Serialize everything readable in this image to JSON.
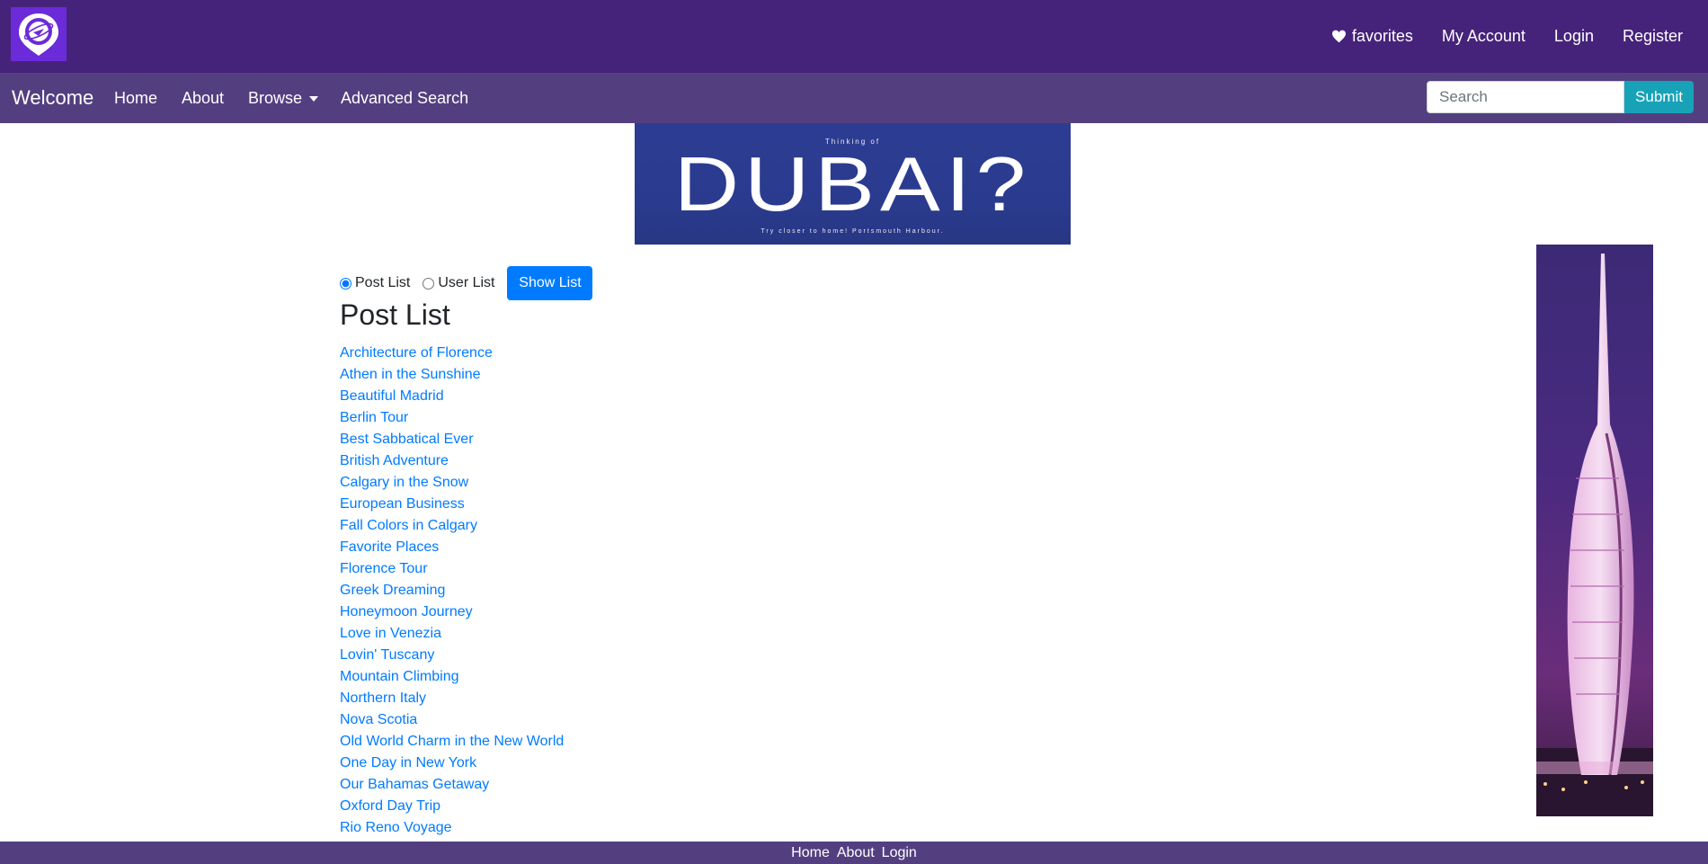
{
  "header": {
    "logo_icon": "globe-pin-icon",
    "links": {
      "favorites": "favorites",
      "favorites_icon": "heart-icon",
      "account": "My Account",
      "login": "Login",
      "register": "Register"
    }
  },
  "navbar": {
    "brand": "Welcome",
    "items": {
      "home": "Home",
      "about": "About",
      "browse": "Browse",
      "advanced": "Advanced Search"
    },
    "search": {
      "placeholder": "Search",
      "value": ""
    },
    "submit": "Submit"
  },
  "ad_banner": {
    "top_line": "Thinking of",
    "headline": "DUBAI?",
    "bottom_line": "Try closer to home! Portsmouth Harbour."
  },
  "list_controls": {
    "options": [
      "Post List",
      "User List"
    ],
    "selected": "Post List",
    "button": "Show List"
  },
  "post_list": {
    "heading": "Post List",
    "items": [
      "Architecture of Florence",
      "Athen in the Sunshine",
      "Beautiful Madrid",
      "Berlin Tour",
      "Best Sabbatical Ever",
      "British Adventure",
      "Calgary in the Snow",
      "European Business",
      "Fall Colors in Calgary",
      "Favorite Places",
      "Florence Tour",
      "Greek Dreaming",
      "Honeymoon Journey",
      "Love in Venezia",
      "Lovin' Tuscany",
      "Mountain Climbing",
      "Northern Italy",
      "Nova Scotia",
      "Old World Charm in the New World",
      "One Day in New York",
      "Our Bahamas Getaway",
      "Oxford Day Trip",
      "Rio Reno Voyage"
    ]
  },
  "footer": {
    "links": [
      "Home",
      "About",
      "Login"
    ]
  },
  "colors": {
    "header_bg": "#46237a",
    "navbar_bg": "#533f80",
    "link": "#007bff",
    "submit": "#17a2b8",
    "primary_button": "#007bff"
  }
}
